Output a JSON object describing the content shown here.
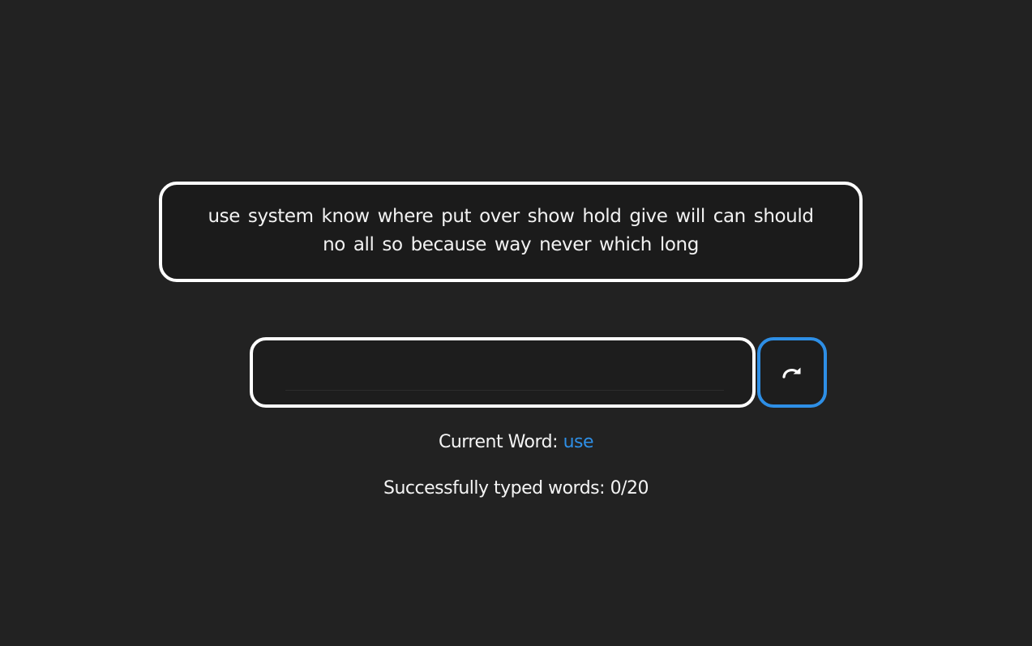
{
  "words_panel": {
    "text": "use system know where put over show hold give will can should no all so because way never which long"
  },
  "typing_input": {
    "value": "",
    "placeholder": ""
  },
  "reset_button": {
    "icon": "redo-arrow-icon"
  },
  "status": {
    "current_word_label": "Current Word:",
    "current_word": "use",
    "typed_label": "Successfully typed words:",
    "typed_count": "0/20"
  },
  "colors": {
    "background": "#222222",
    "accent": "#2e8fe6",
    "border": "#ffffff"
  }
}
